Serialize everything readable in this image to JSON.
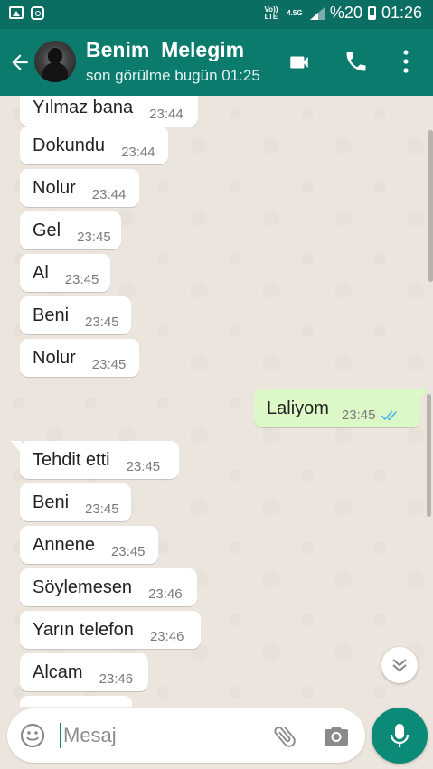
{
  "status_bar": {
    "volte_label": "Vo)) LTE",
    "network_label": "4.5G",
    "battery_text": "%20",
    "time": "01:26"
  },
  "header": {
    "contact_name": "Benim  Melegim",
    "last_seen": "son görülme bugün 01:25",
    "color": "#0b7b6d"
  },
  "messages": [
    {
      "text": "Yılmaz bana",
      "time": "23:44",
      "direction": "in"
    },
    {
      "text": "Dokundu",
      "time": "23:44",
      "direction": "in"
    },
    {
      "text": "Nolur",
      "time": "23:44",
      "direction": "in"
    },
    {
      "text": "Gel",
      "time": "23:45",
      "direction": "in"
    },
    {
      "text": "Al",
      "time": "23:45",
      "direction": "in"
    },
    {
      "text": "Beni",
      "time": "23:45",
      "direction": "in"
    },
    {
      "text": "Nolur",
      "time": "23:45",
      "direction": "in"
    },
    {
      "text": "Laliyom",
      "time": "23:45",
      "direction": "out",
      "status": "read"
    },
    {
      "text": "Tehdit etti",
      "time": "23:45",
      "direction": "in"
    },
    {
      "text": "Beni",
      "time": "23:45",
      "direction": "in"
    },
    {
      "text": "Annene",
      "time": "23:45",
      "direction": "in"
    },
    {
      "text": "Söylemesen",
      "time": "23:46",
      "direction": "in"
    },
    {
      "text": "Yarın telefon",
      "time": "23:46",
      "direction": "in"
    },
    {
      "text": "Alcam",
      "time": "23:46",
      "direction": "in"
    }
  ],
  "composer": {
    "placeholder": "Mesaj",
    "value": ""
  },
  "colors": {
    "accent": "#0b8a78",
    "outgoing_bubble": "#dcf8c6",
    "incoming_bubble": "#ffffff",
    "read_ticks": "#4fb6ec",
    "chat_background": "#ece5dd"
  },
  "icons": {
    "back": "arrow-left-icon",
    "video": "video-call-icon",
    "phone": "phone-icon",
    "menu": "more-vert-icon",
    "emoji": "emoji-icon",
    "attach": "paperclip-icon",
    "camera": "camera-icon",
    "mic": "mic-icon",
    "scroll_down": "double-chevron-down-icon"
  }
}
